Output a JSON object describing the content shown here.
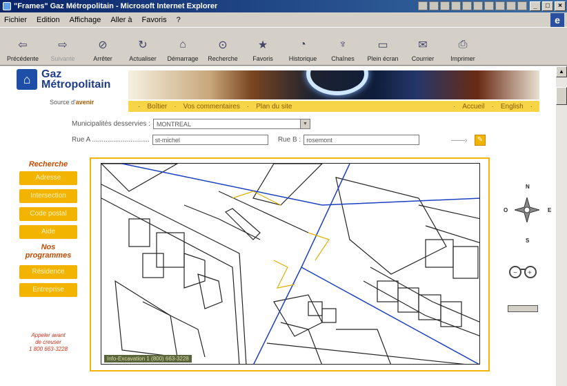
{
  "window": {
    "title": "\"Frames\" Gaz Métropolitain - Microsoft Internet Explorer"
  },
  "menu": [
    "Fichier",
    "Edition",
    "Affichage",
    "Aller à",
    "Favoris",
    "?"
  ],
  "toolbar": [
    {
      "label": "Précédente",
      "icon": "back-arrow-icon",
      "enabled": true
    },
    {
      "label": "Suivante",
      "icon": "forward-arrow-icon",
      "enabled": false
    },
    {
      "label": "Arrêter",
      "icon": "stop-icon",
      "enabled": true
    },
    {
      "label": "Actualiser",
      "icon": "refresh-icon",
      "enabled": true
    },
    {
      "label": "Démarrage",
      "icon": "home-icon",
      "enabled": true
    },
    {
      "label": "Recherche",
      "icon": "search-icon",
      "enabled": true
    },
    {
      "label": "Favoris",
      "icon": "favorites-icon",
      "enabled": true
    },
    {
      "label": "Historique",
      "icon": "history-icon",
      "enabled": true
    },
    {
      "label": "Chaînes",
      "icon": "channels-icon",
      "enabled": true
    },
    {
      "label": "Plein écran",
      "icon": "fullscreen-icon",
      "enabled": true
    },
    {
      "label": "Courrier",
      "icon": "mail-icon",
      "enabled": true
    },
    {
      "label": "Imprimer",
      "icon": "print-icon",
      "enabled": true
    }
  ],
  "site": {
    "brand_line1": "Gaz",
    "brand_line2": "Métropolitain",
    "tagline_prefix": "Source d'",
    "tagline_em": "avenir",
    "nav_left": [
      "Boîtier",
      "Vos commentaires",
      "Plan du site"
    ],
    "nav_right": [
      "Accueil",
      "English"
    ]
  },
  "form": {
    "municipality_label": "Municipalités desservies :",
    "municipality_value": "MONTREAL",
    "street_a_label": "Rue A ..............................",
    "street_a_value": "st-michel",
    "street_b_label": "Rue B :",
    "street_b_value": "rosemont"
  },
  "sidebar": {
    "title": "Recherche",
    "buttons": [
      "Adresse",
      "Intersection",
      "Code postal",
      "Aide"
    ],
    "subtitle_line1": "Nos",
    "subtitle_line2": "programmes",
    "programs": [
      "Résidence",
      "Entreprise"
    ],
    "call_line1": "Appeler avant",
    "call_line2": "de creuser",
    "call_number": "1 800 663-3228"
  },
  "map": {
    "scale_text": "Info-Excavation 1 (800) 663-3228",
    "compass": {
      "n": "N",
      "s": "S",
      "e": "E",
      "o": "O"
    }
  },
  "colors": {
    "accent": "#f2b400",
    "brand": "#1e4fa8",
    "mapline_blue": "#1a3fc0",
    "mapline_yellow": "#e0b000"
  }
}
